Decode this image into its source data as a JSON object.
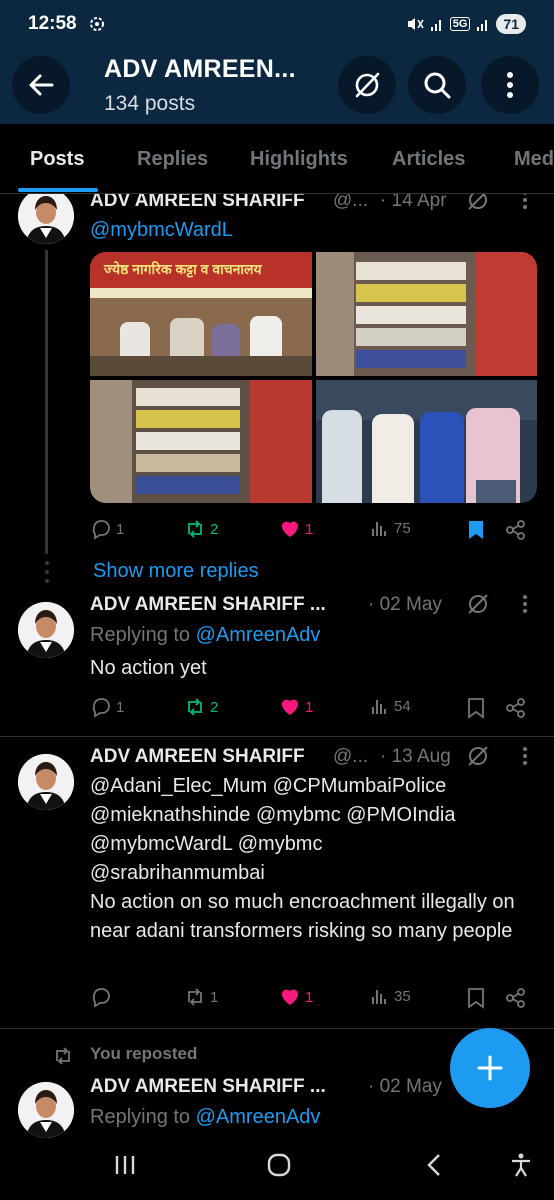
{
  "status_bar": {
    "time": "12:58",
    "network": "5G",
    "battery": "71"
  },
  "header": {
    "title": "ADV AMREEN...",
    "subtitle": "134 posts"
  },
  "tabs": [
    {
      "label": "Posts",
      "active": true
    },
    {
      "label": "Replies"
    },
    {
      "label": "Highlights"
    },
    {
      "label": "Articles"
    },
    {
      "label": "Med"
    }
  ],
  "posts": [
    {
      "name": "ADV AMREEN SHARIFF",
      "handle": "@...",
      "date": "· 14 Apr",
      "mention": "@mybmcWardL",
      "media_caption": "ज्येष्ठ नागरिक कट्टा व वाचनालय",
      "actions": {
        "replies": "1",
        "reposts": "2",
        "likes": "1",
        "views": "75"
      }
    },
    {
      "show_more": "Show more replies"
    },
    {
      "name": "ADV AMREEN SHARIFF ...",
      "date": "· 02 May",
      "replying_to_label": "Replying to",
      "replying_to_handle": "@AmreenAdv",
      "text": "No action yet",
      "actions": {
        "replies": "1",
        "reposts": "2",
        "likes": "1",
        "views": "54"
      }
    },
    {
      "name": "ADV AMREEN SHARIFF",
      "handle": "@...",
      "date": "· 13 Aug",
      "mentions_line1": "@Adani_Elec_Mum @CPMumbaiPolice",
      "mentions_line2": "@mieknathshinde @mybmc @PMOIndia",
      "mentions_line3": "@mybmcWardL @mybmc",
      "mentions_line4": "@srabrihanmumbai",
      "text": "No action on so much encroachment illegally on near adani transformers risking so many people",
      "actions": {
        "replies": "",
        "reposts": "1",
        "likes": "1",
        "views": "35"
      }
    },
    {
      "reposted_label": "You reposted",
      "name": "ADV AMREEN SHARIFF ...",
      "date": "· 02 May",
      "replying_to_label": "Replying to",
      "replying_to_handle": "@AmreenAdv"
    }
  ],
  "colors": {
    "accent": "#1d9bf0",
    "header_bg": "#0c2840",
    "like": "#f91880",
    "repost": "#00ba7c"
  }
}
